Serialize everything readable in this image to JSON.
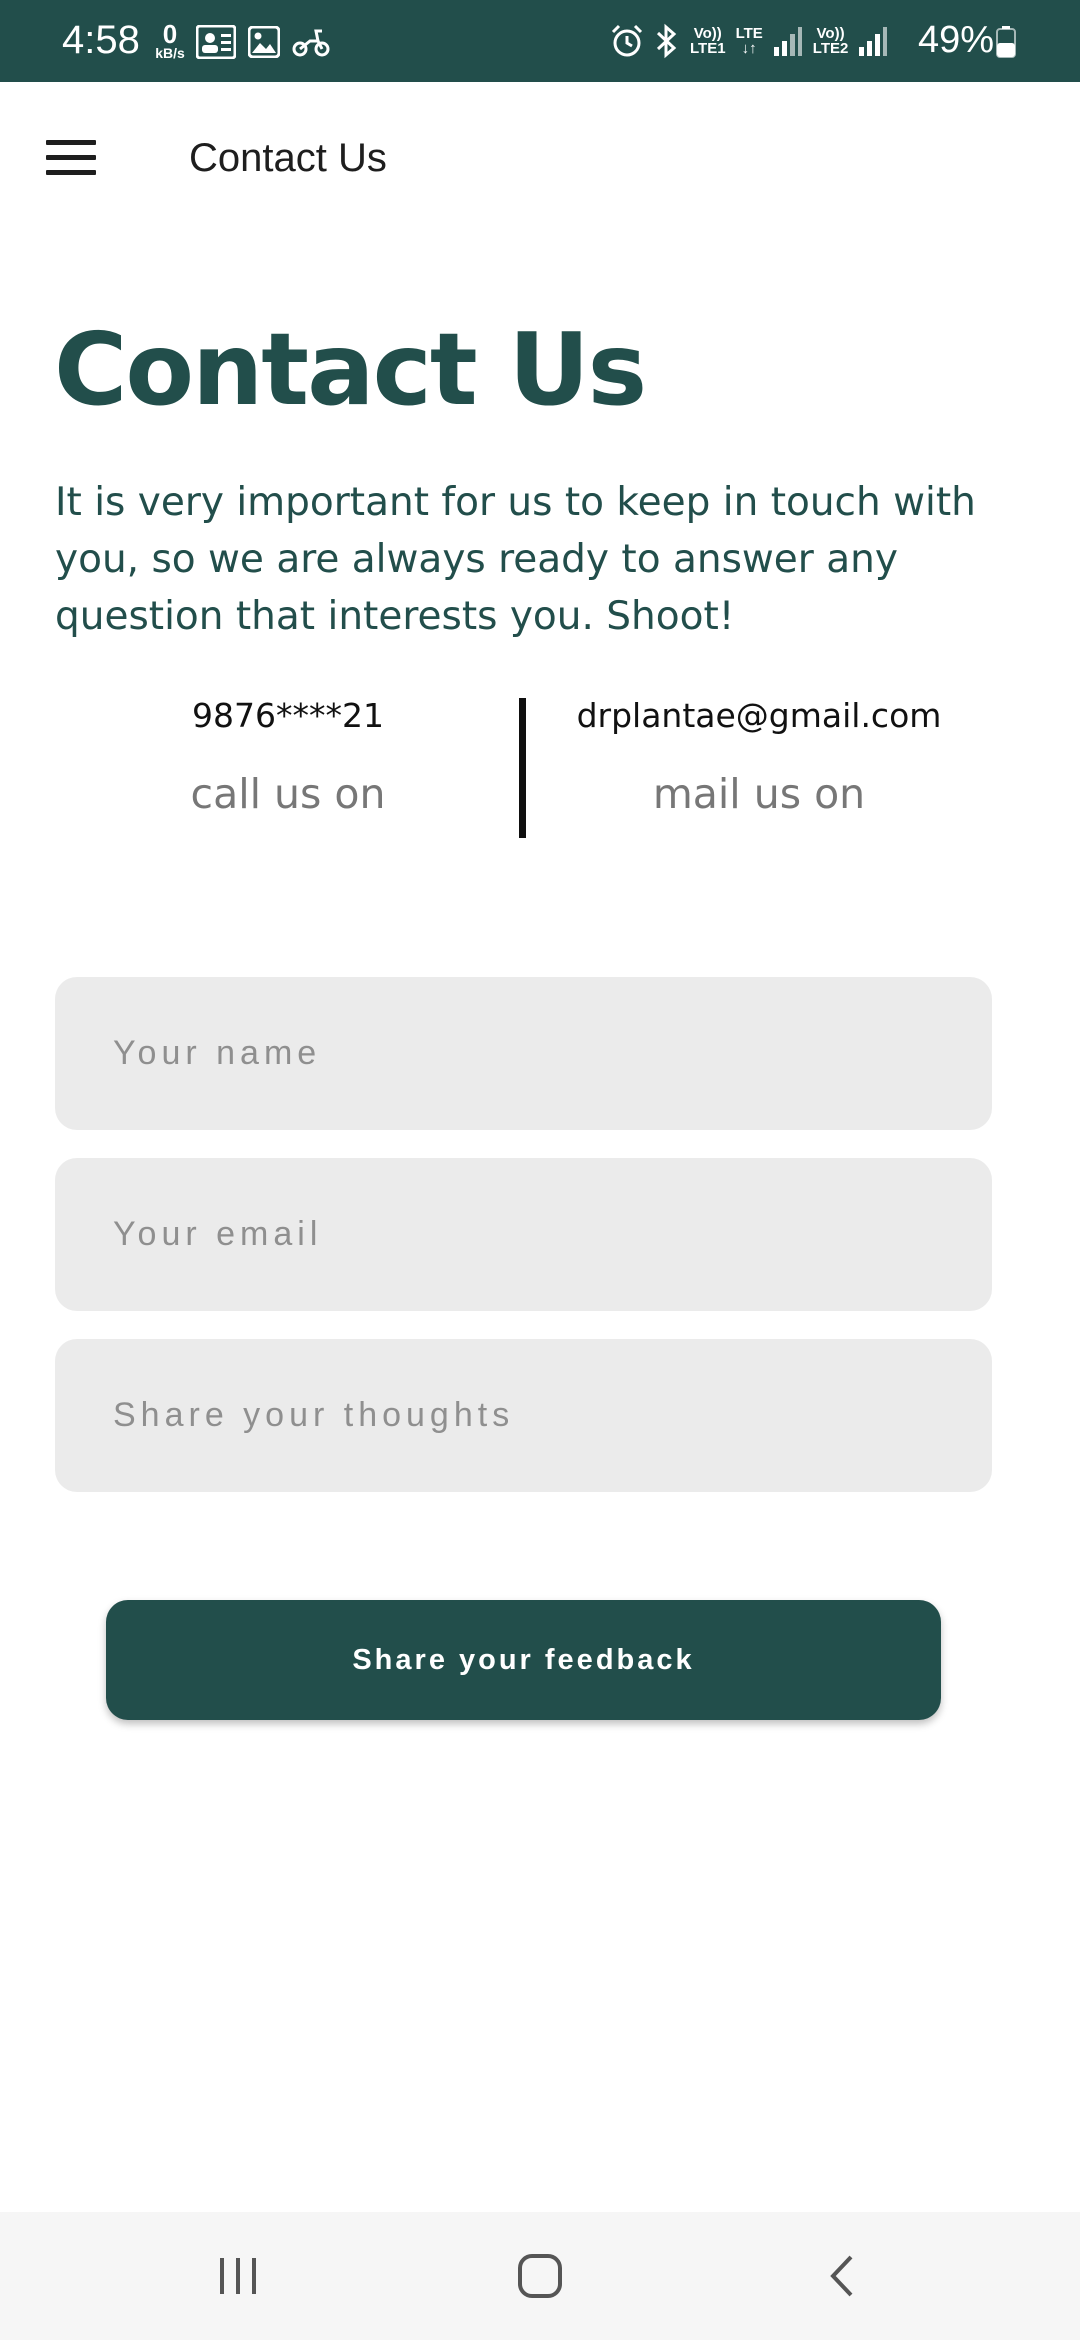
{
  "status_bar": {
    "time": "4:58",
    "network_speed_value": "0",
    "network_speed_unit": "kB/s",
    "sim1_label": "Vo)) LTE1",
    "sim1_label_top": "Vo))",
    "sim1_label_bottom": "LTE1",
    "lte_label": "LTE",
    "sim2_label_top": "Vo))",
    "sim2_label_bottom": "LTE2",
    "battery_percent": "49%",
    "icons": [
      "contacts-card-icon",
      "gallery-icon",
      "scooter-icon",
      "alarm-icon",
      "bluetooth-icon",
      "signal-icon",
      "battery-icon"
    ],
    "background_color": "#224e4b"
  },
  "app_bar": {
    "title": "Contact Us",
    "menu_icon": "hamburger-menu-icon"
  },
  "main": {
    "heading": "Contact Us",
    "intro": "It is very important for us to keep in touch with you, so we are always ready to answer any question that interests you. Shoot!",
    "phone": {
      "value": "9876****21",
      "label": "call us on"
    },
    "email": {
      "value": "drplantae@gmail.com",
      "label": "mail us on"
    },
    "form": {
      "name_placeholder": "Your name",
      "name_value": "",
      "email_placeholder": "Your email",
      "email_value": "",
      "thoughts_placeholder": "Share your thoughts",
      "thoughts_value": "",
      "submit_label": "Share your feedback"
    }
  },
  "nav_bar": {
    "buttons": [
      "recents-icon",
      "home-icon",
      "back-icon"
    ]
  },
  "colors": {
    "brand": "#224e4b",
    "field_background": "#ebebeb",
    "label_gray": "#777777"
  }
}
